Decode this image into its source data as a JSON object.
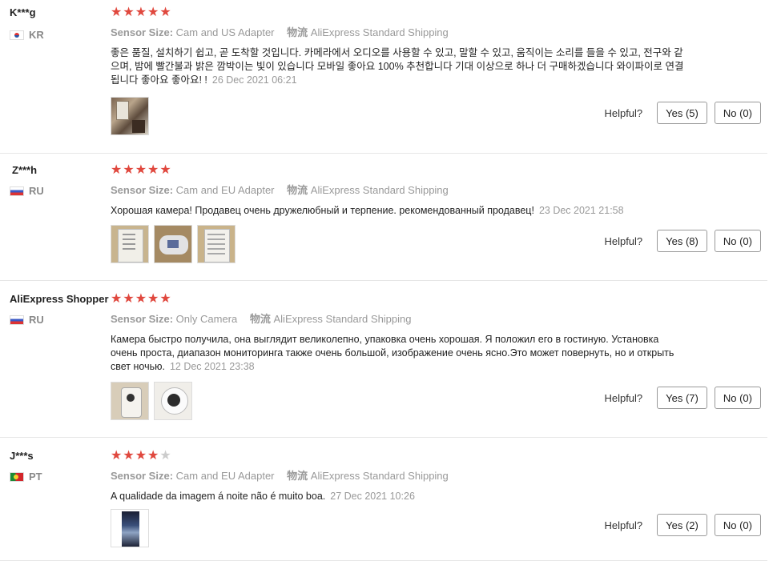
{
  "labels": {
    "sensor": "Sensor Size:",
    "shipping_icon": "物流",
    "helpful": "Helpful?"
  },
  "reviews": [
    {
      "user": "K***g",
      "country": "KR",
      "flag": "kr",
      "rating": 5,
      "sensor": "Cam and US Adapter",
      "shipping": "AliExpress Standard Shipping",
      "text": "좋은 품질, 설치하기 쉽고, 곧 도착할 것입니다. 카메라에서 오디오를 사용할 수 있고, 말할 수 있고, 움직이는 소리를 들을 수 있고, 전구와 같으며, 밤에 빨간불과 밝은 깜박이는 빛이 있습니다 모바일 좋아요 100% 추천합니다 기대 이상으로 하나 더 구매하겠습니다 와이파이로 연결됩니다 좋아요 좋아요! !",
      "date": "26 Dec 2021 06:21",
      "yes": "Yes (5)",
      "no": "No (0)"
    },
    {
      "user": "Z***h",
      "country": "RU",
      "flag": "ru",
      "rating": 5,
      "sensor": "Cam and EU Adapter",
      "shipping": "AliExpress Standard Shipping",
      "text": "Хорошая камера! Продавец очень дружелюбный и терпение. рекомендованный продавец!",
      "date": "23 Dec 2021 21:58",
      "yes": "Yes (8)",
      "no": "No (0)"
    },
    {
      "user": "AliExpress Shopper",
      "country": "RU",
      "flag": "ru",
      "rating": 5,
      "sensor": "Only Camera",
      "shipping": "AliExpress Standard Shipping",
      "text": "Камера быстро получила, она выглядит великолепно, упаковка очень хорошая. Я положил его в гостиную. Установка очень проста, диапазон мониторинга также очень большой, изображение очень ясно.Это может повернуть, но и открыть свет ночью.",
      "date": "12 Dec 2021 23:38",
      "yes": "Yes (7)",
      "no": "No (0)"
    },
    {
      "user": "J***s",
      "country": "PT",
      "flag": "pt",
      "rating": 4,
      "sensor": "Cam and EU Adapter",
      "shipping": "AliExpress Standard Shipping",
      "text": "A qualidade da imagem á noite não é muito boa.",
      "date": "27 Dec 2021 10:26",
      "yes": "Yes (2)",
      "no": "No (0)"
    }
  ]
}
